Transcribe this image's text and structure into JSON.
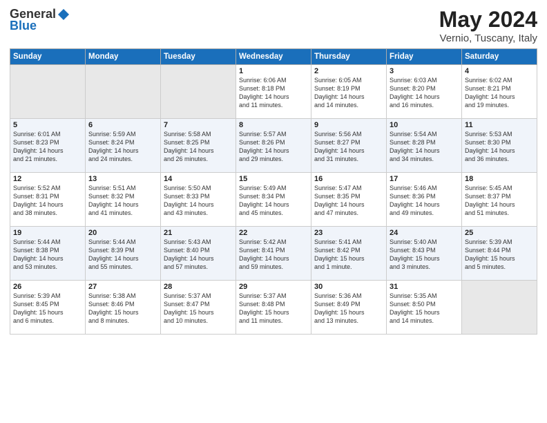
{
  "header": {
    "logo_general": "General",
    "logo_blue": "Blue",
    "month_title": "May 2024",
    "location": "Vernio, Tuscany, Italy"
  },
  "weekdays": [
    "Sunday",
    "Monday",
    "Tuesday",
    "Wednesday",
    "Thursday",
    "Friday",
    "Saturday"
  ],
  "weeks": [
    [
      {
        "day": "",
        "info": ""
      },
      {
        "day": "",
        "info": ""
      },
      {
        "day": "",
        "info": ""
      },
      {
        "day": "1",
        "info": "Sunrise: 6:06 AM\nSunset: 8:18 PM\nDaylight: 14 hours\nand 11 minutes."
      },
      {
        "day": "2",
        "info": "Sunrise: 6:05 AM\nSunset: 8:19 PM\nDaylight: 14 hours\nand 14 minutes."
      },
      {
        "day": "3",
        "info": "Sunrise: 6:03 AM\nSunset: 8:20 PM\nDaylight: 14 hours\nand 16 minutes."
      },
      {
        "day": "4",
        "info": "Sunrise: 6:02 AM\nSunset: 8:21 PM\nDaylight: 14 hours\nand 19 minutes."
      }
    ],
    [
      {
        "day": "5",
        "info": "Sunrise: 6:01 AM\nSunset: 8:23 PM\nDaylight: 14 hours\nand 21 minutes."
      },
      {
        "day": "6",
        "info": "Sunrise: 5:59 AM\nSunset: 8:24 PM\nDaylight: 14 hours\nand 24 minutes."
      },
      {
        "day": "7",
        "info": "Sunrise: 5:58 AM\nSunset: 8:25 PM\nDaylight: 14 hours\nand 26 minutes."
      },
      {
        "day": "8",
        "info": "Sunrise: 5:57 AM\nSunset: 8:26 PM\nDaylight: 14 hours\nand 29 minutes."
      },
      {
        "day": "9",
        "info": "Sunrise: 5:56 AM\nSunset: 8:27 PM\nDaylight: 14 hours\nand 31 minutes."
      },
      {
        "day": "10",
        "info": "Sunrise: 5:54 AM\nSunset: 8:28 PM\nDaylight: 14 hours\nand 34 minutes."
      },
      {
        "day": "11",
        "info": "Sunrise: 5:53 AM\nSunset: 8:30 PM\nDaylight: 14 hours\nand 36 minutes."
      }
    ],
    [
      {
        "day": "12",
        "info": "Sunrise: 5:52 AM\nSunset: 8:31 PM\nDaylight: 14 hours\nand 38 minutes."
      },
      {
        "day": "13",
        "info": "Sunrise: 5:51 AM\nSunset: 8:32 PM\nDaylight: 14 hours\nand 41 minutes."
      },
      {
        "day": "14",
        "info": "Sunrise: 5:50 AM\nSunset: 8:33 PM\nDaylight: 14 hours\nand 43 minutes."
      },
      {
        "day": "15",
        "info": "Sunrise: 5:49 AM\nSunset: 8:34 PM\nDaylight: 14 hours\nand 45 minutes."
      },
      {
        "day": "16",
        "info": "Sunrise: 5:47 AM\nSunset: 8:35 PM\nDaylight: 14 hours\nand 47 minutes."
      },
      {
        "day": "17",
        "info": "Sunrise: 5:46 AM\nSunset: 8:36 PM\nDaylight: 14 hours\nand 49 minutes."
      },
      {
        "day": "18",
        "info": "Sunrise: 5:45 AM\nSunset: 8:37 PM\nDaylight: 14 hours\nand 51 minutes."
      }
    ],
    [
      {
        "day": "19",
        "info": "Sunrise: 5:44 AM\nSunset: 8:38 PM\nDaylight: 14 hours\nand 53 minutes."
      },
      {
        "day": "20",
        "info": "Sunrise: 5:44 AM\nSunset: 8:39 PM\nDaylight: 14 hours\nand 55 minutes."
      },
      {
        "day": "21",
        "info": "Sunrise: 5:43 AM\nSunset: 8:40 PM\nDaylight: 14 hours\nand 57 minutes."
      },
      {
        "day": "22",
        "info": "Sunrise: 5:42 AM\nSunset: 8:41 PM\nDaylight: 14 hours\nand 59 minutes."
      },
      {
        "day": "23",
        "info": "Sunrise: 5:41 AM\nSunset: 8:42 PM\nDaylight: 15 hours\nand 1 minute."
      },
      {
        "day": "24",
        "info": "Sunrise: 5:40 AM\nSunset: 8:43 PM\nDaylight: 15 hours\nand 3 minutes."
      },
      {
        "day": "25",
        "info": "Sunrise: 5:39 AM\nSunset: 8:44 PM\nDaylight: 15 hours\nand 5 minutes."
      }
    ],
    [
      {
        "day": "26",
        "info": "Sunrise: 5:39 AM\nSunset: 8:45 PM\nDaylight: 15 hours\nand 6 minutes."
      },
      {
        "day": "27",
        "info": "Sunrise: 5:38 AM\nSunset: 8:46 PM\nDaylight: 15 hours\nand 8 minutes."
      },
      {
        "day": "28",
        "info": "Sunrise: 5:37 AM\nSunset: 8:47 PM\nDaylight: 15 hours\nand 10 minutes."
      },
      {
        "day": "29",
        "info": "Sunrise: 5:37 AM\nSunset: 8:48 PM\nDaylight: 15 hours\nand 11 minutes."
      },
      {
        "day": "30",
        "info": "Sunrise: 5:36 AM\nSunset: 8:49 PM\nDaylight: 15 hours\nand 13 minutes."
      },
      {
        "day": "31",
        "info": "Sunrise: 5:35 AM\nSunset: 8:50 PM\nDaylight: 15 hours\nand 14 minutes."
      },
      {
        "day": "",
        "info": ""
      }
    ]
  ]
}
